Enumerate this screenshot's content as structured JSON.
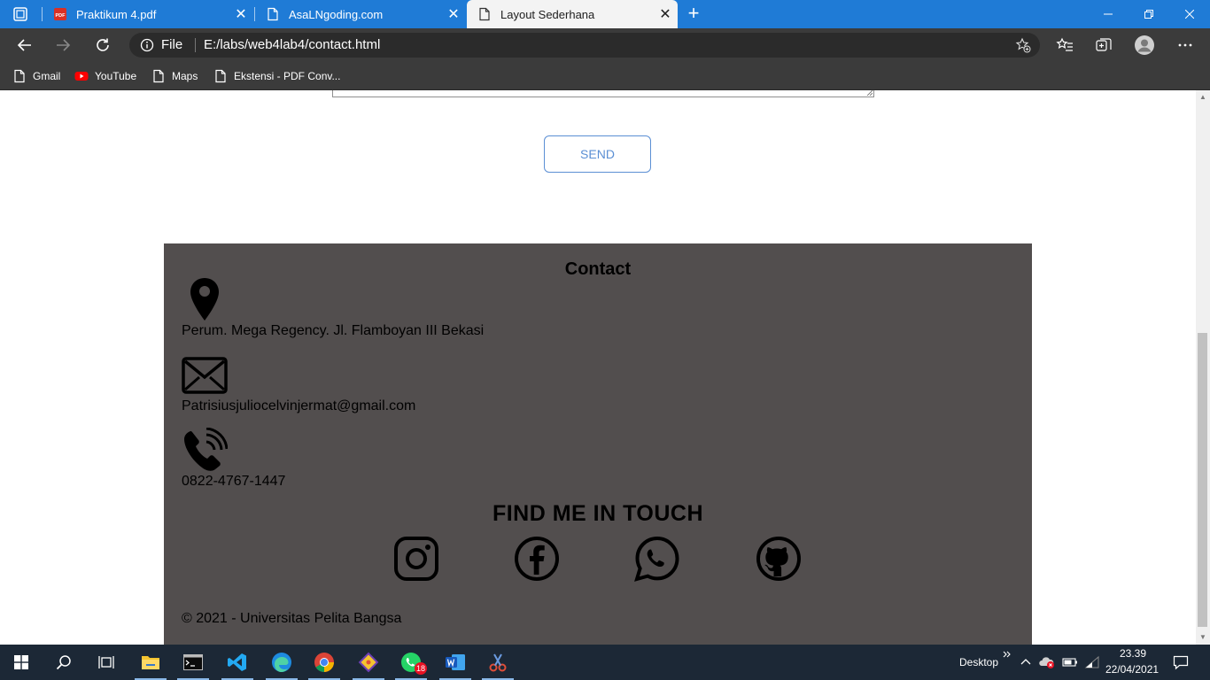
{
  "browser": {
    "tabs": [
      {
        "label": "Praktikum 4.pdf",
        "icon": "pdf-icon"
      },
      {
        "label": "AsaLNgoding.com",
        "icon": "page-icon"
      },
      {
        "label": "Layout Sederhana",
        "icon": "page-icon",
        "active": true
      }
    ],
    "close_glyph": "✕",
    "new_tab_glyph": "+",
    "address": {
      "scheme": "File",
      "url": "E:/labs/web4lab4/contact.html"
    },
    "bookmarks": [
      {
        "label": "Gmail",
        "icon": "page-icon"
      },
      {
        "label": "YouTube",
        "icon": "youtube-icon"
      },
      {
        "label": "Maps",
        "icon": "page-icon"
      },
      {
        "label": "Ekstensi - PDF Conv...",
        "icon": "page-icon"
      }
    ]
  },
  "page": {
    "send_label": "SEND",
    "contact": {
      "title": "Contact",
      "address": "Perum. Mega Regency. Jl. Flamboyan III Bekasi",
      "email": "Patrisiusjuliocelvinjermat@gmail.com",
      "phone": "0822-4767-1447"
    },
    "find_title": "FIND ME IN TOUCH",
    "social_icons": [
      "instagram-icon",
      "facebook-icon",
      "whatsapp-icon",
      "github-icon"
    ],
    "copyright": "© 2021 - Universitas Pelita Bangsa"
  },
  "taskbar": {
    "desktop_label": "Desktop",
    "time": "23.39",
    "date": "22/04/2021",
    "whatsapp_badge": "18"
  },
  "colors": {
    "tab_bar": "#1f7bd6",
    "browser_chrome": "#3b3b3b",
    "footer_bg": "#524e4e",
    "send_accent": "#5b8fd4",
    "taskbar": "#1c2836"
  }
}
